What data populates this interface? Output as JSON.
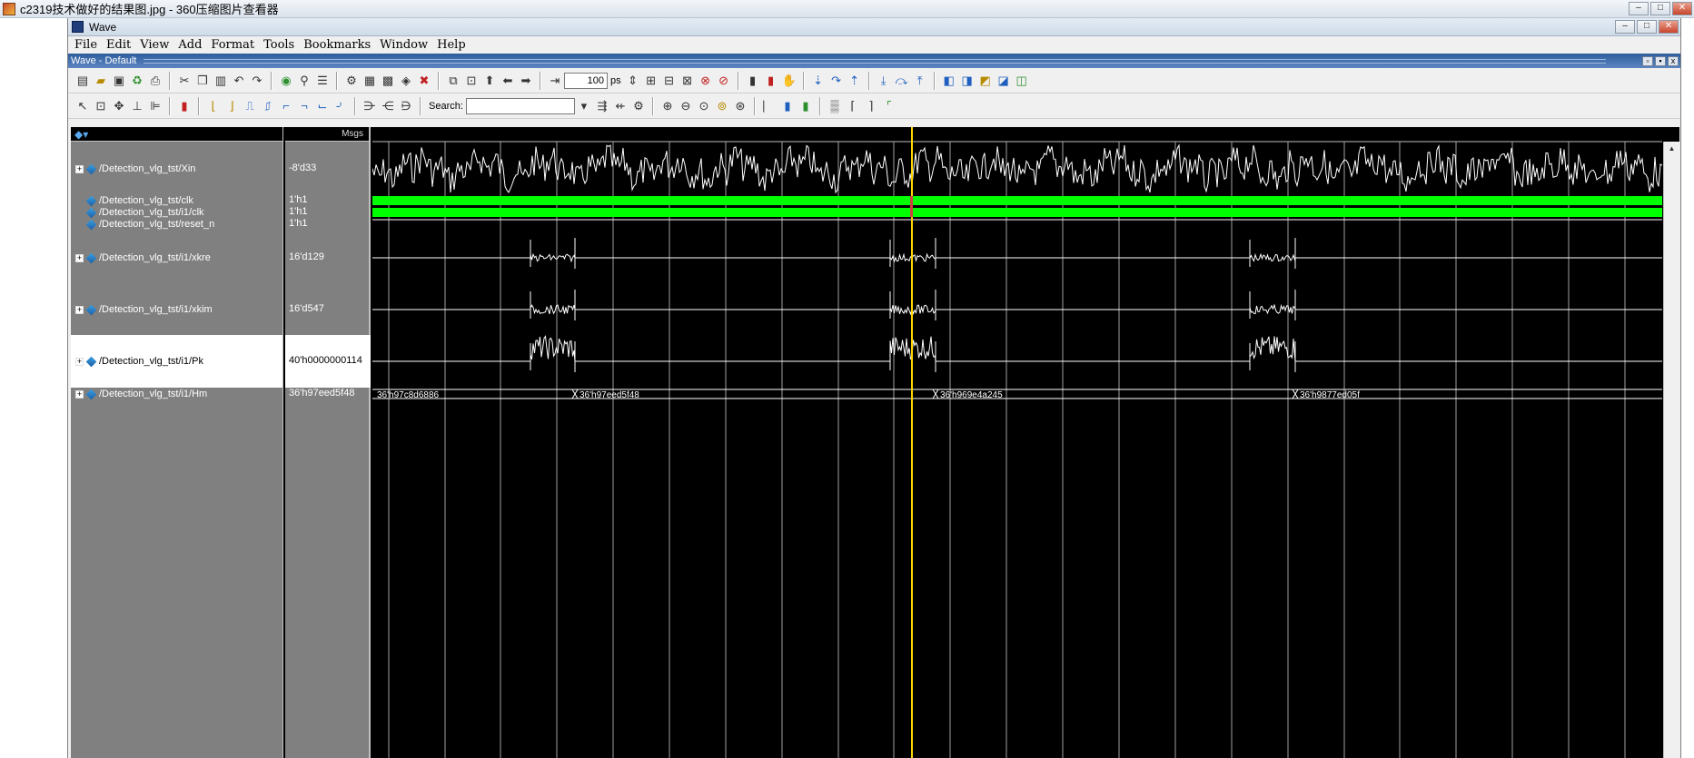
{
  "viewer": {
    "title": "c2319技术做好的结果图.jpg - 360压缩图片查看器"
  },
  "wave_window": {
    "title": "Wave"
  },
  "menu": [
    "File",
    "Edit",
    "View",
    "Add",
    "Format",
    "Tools",
    "Bookmarks",
    "Window",
    "Help"
  ],
  "subtitle": "Wave - Default",
  "toolbar": {
    "time_value": "100",
    "time_unit": "ps",
    "search_label": "Search:",
    "search_value": ""
  },
  "panes": {
    "msgs_header": "Msgs"
  },
  "signals": [
    {
      "name": "/Detection_vlg_tst/Xin",
      "value": "-8'd33",
      "expandable": true,
      "wave": "analog"
    },
    {
      "name": "/Detection_vlg_tst/clk",
      "value": "1'h1",
      "expandable": false,
      "wave": "clock"
    },
    {
      "name": "/Detection_vlg_tst/i1/clk",
      "value": "1'h1",
      "expandable": false,
      "wave": "clock"
    },
    {
      "name": "/Detection_vlg_tst/reset_n",
      "value": "1'h1",
      "expandable": false,
      "wave": "flat"
    },
    {
      "name": "/Detection_vlg_tst/i1/xkre",
      "value": "16'd129",
      "expandable": true,
      "wave": "bursts"
    },
    {
      "name": "/Detection_vlg_tst/i1/xkim",
      "value": "16'd547",
      "expandable": true,
      "wave": "bursts"
    },
    {
      "name": "/Detection_vlg_tst/i1/Pk",
      "value": "40'h0000000114",
      "expandable": true,
      "wave": "bursts",
      "selected": true
    },
    {
      "name": "/Detection_vlg_tst/i1/Hm",
      "value": "36'h97eed5f48",
      "expandable": true,
      "wave": "bus"
    }
  ],
  "bus_values": [
    "36'h97c8d6886",
    "36'h97eed5f48",
    "36'h969e4a245",
    "36'h9877ed05f"
  ],
  "colors": {
    "wave": "#ffffff",
    "clock": "#00ff00",
    "cursor": "#ffd700",
    "grid": "#a0a0a0",
    "pane_bg": "#808080"
  }
}
